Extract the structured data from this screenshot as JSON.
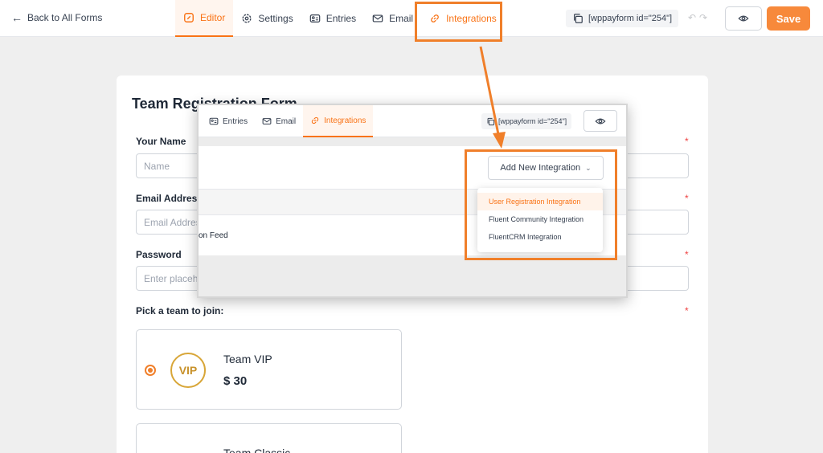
{
  "topbar": {
    "back_label": "Back to All Forms",
    "nav": [
      {
        "label": "Editor",
        "icon": "edit-icon"
      },
      {
        "label": "Settings",
        "icon": "gear-icon"
      },
      {
        "label": "Entries",
        "icon": "id-card-icon"
      },
      {
        "label": "Email",
        "icon": "envelope-icon"
      },
      {
        "label": "Integrations",
        "icon": "link-icon"
      }
    ],
    "shortcode": "[wppayform id=\"254\"]",
    "save_label": "Save"
  },
  "form": {
    "title": "Team Registration Form",
    "fields": [
      {
        "label": "Your Name",
        "placeholder": "Name",
        "required": "*"
      },
      {
        "label": "Email Address",
        "placeholder": "Email Address",
        "required": "*"
      },
      {
        "label": "Password",
        "placeholder": "Enter placeholder",
        "required": "*"
      }
    ],
    "team_label": "Pick a team to join:",
    "team_required": "*",
    "teams": [
      {
        "name": "Team VIP",
        "price": "$ 30",
        "badge": "VIP"
      },
      {
        "name": "Team Classic"
      }
    ]
  },
  "overlay": {
    "nav": [
      {
        "label": "Entries",
        "icon": "id-card-icon"
      },
      {
        "label": "Email",
        "icon": "envelope-icon"
      },
      {
        "label": "Integrations",
        "icon": "link-icon"
      }
    ],
    "shortcode": "[wppayform id=\"254\"]",
    "add_integration_label": "Add New Integration",
    "feed_text": "on Feed",
    "dropdown": [
      "User Registration Integration",
      "Fluent Community Integration",
      "FluentCRM Integration"
    ]
  },
  "colors": {
    "accent": "#f97316",
    "highlight": "#f07f2a",
    "save_bg": "#f7893b"
  }
}
